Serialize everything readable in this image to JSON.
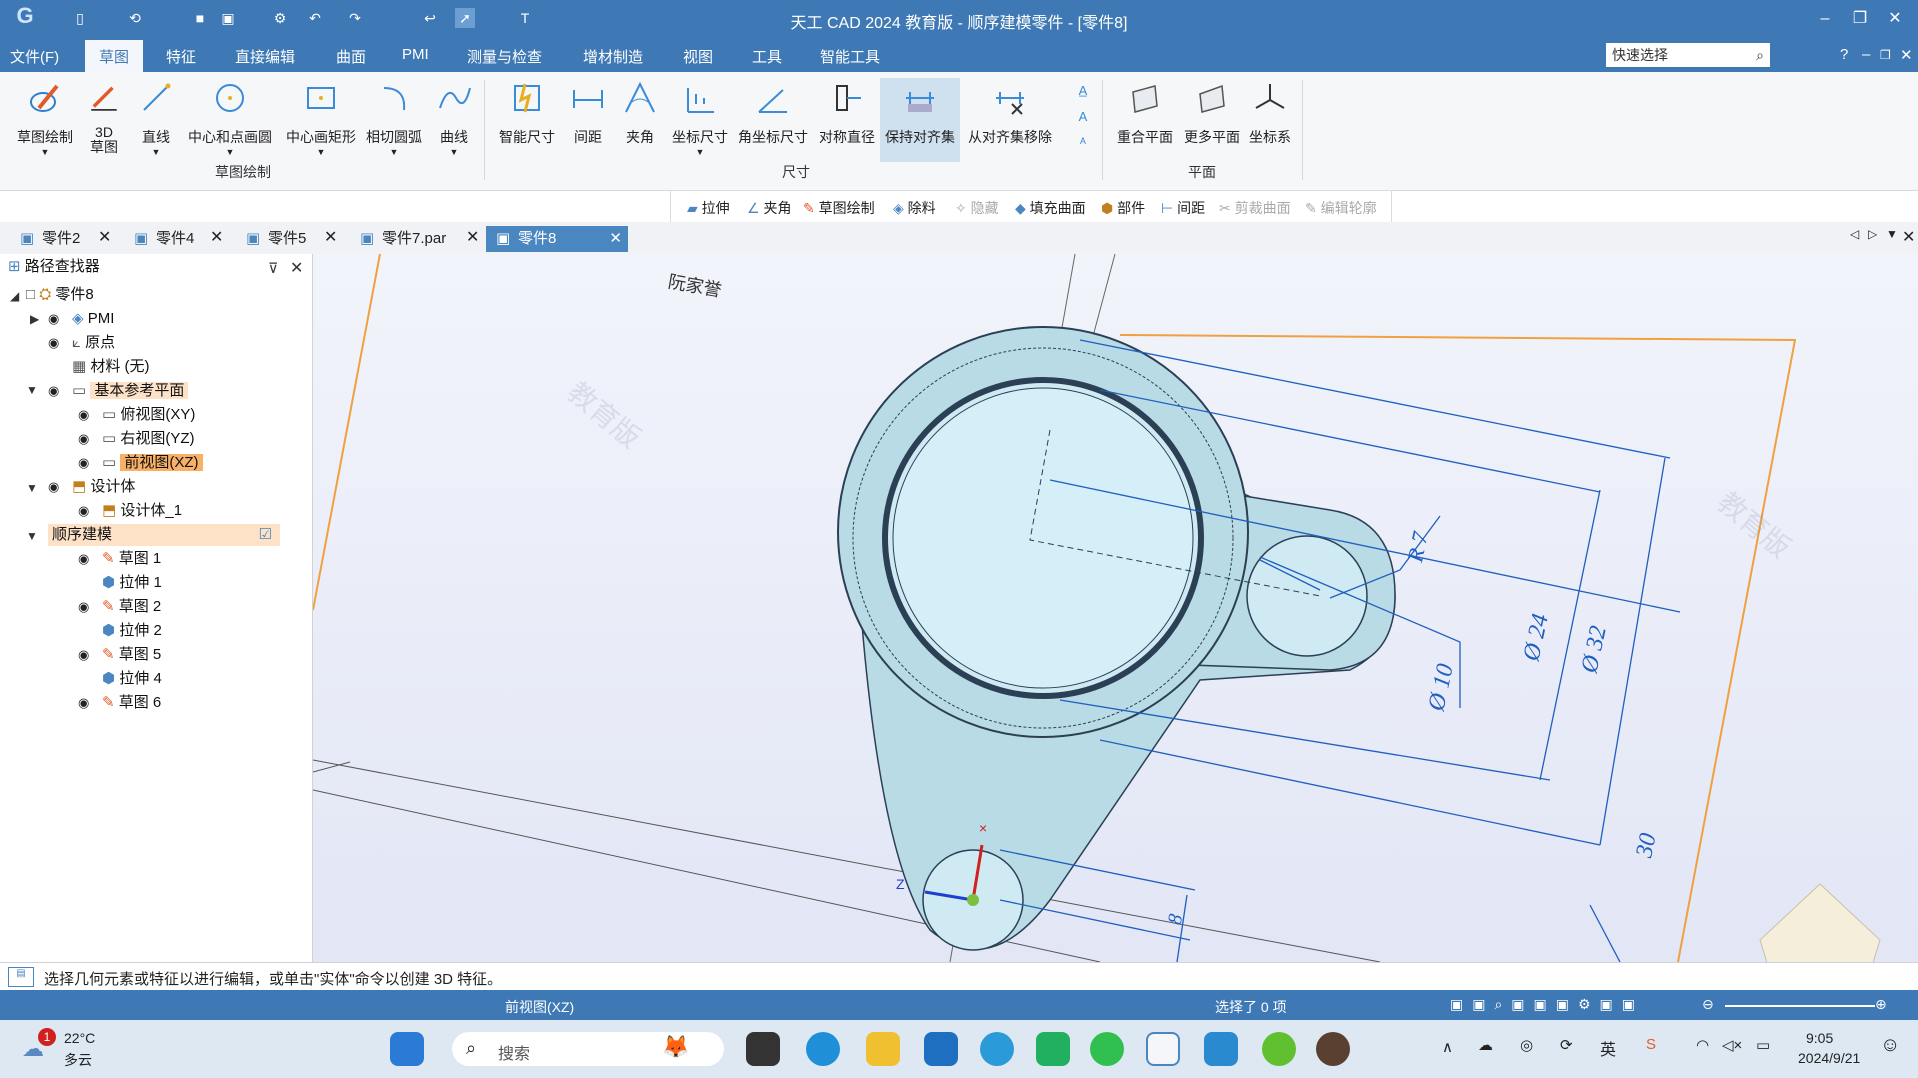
{
  "titlebar": {
    "title": "天工 CAD 2024 教育版 - 顺序建模零件 - [零件8]"
  },
  "menu": {
    "file": "文件(F)",
    "sketch": "草图",
    "feature": "特征",
    "direct_edit": "直接编辑",
    "surface": "曲面",
    "pmi": "PMI",
    "measure": "测量与检查",
    "additive": "增材制造",
    "view": "视图",
    "tools": "工具",
    "smart_tools": "智能工具",
    "quick_select": "快速选择",
    "help": "?"
  },
  "ribbon": {
    "sketch_draw": "草图绘制",
    "sketch3d_a": "3D",
    "sketch3d_b": "草图",
    "line": "直线",
    "center_circle": "中心和点画圆",
    "center_rect": "中心画矩形",
    "tangent_arc": "相切圆弧",
    "curve": "曲线",
    "group_sketch": "草图绘制",
    "smart_dim": "智能尺寸",
    "distance": "间距",
    "angle": "夹角",
    "coord_dim": "坐标尺寸",
    "angle_coord_dim": "角坐标尺寸",
    "sym_diameter": "对称直径",
    "keep_align": "保持对齐集",
    "remove_align": "从对齐集移除",
    "group_dim": "尺寸",
    "coincident_plane": "重合平面",
    "more_planes": "更多平面",
    "coord_sys": "坐标系",
    "group_plane": "平面"
  },
  "featurebar": {
    "extrude": "拉伸",
    "angle": "夹角",
    "sketch": "草图绘制",
    "remove": "除料",
    "hide": "隐藏",
    "fill_surface": "填充曲面",
    "part": "部件",
    "distance": "间距",
    "trim_surface": "剪裁曲面",
    "edit_profile": "编辑轮廓"
  },
  "tabs": [
    "零件2",
    "零件4",
    "零件5",
    "零件7.par",
    "零件8"
  ],
  "pathfinder": {
    "title": "路径查找器",
    "root": "零件8",
    "pmi": "PMI",
    "origin": "原点",
    "material": "材料 (无)",
    "base_planes": "基本参考平面",
    "top_view": "俯视图(XY)",
    "right_view": "右视图(YZ)",
    "front_view": "前视图(XZ)",
    "design_body": "设计体",
    "design_body_1": "设计体_1",
    "sequential": "顺序建模",
    "items": [
      "草图 1",
      "拉伸 1",
      "草图 2",
      "拉伸 2",
      "草图 5",
      "拉伸 4",
      "草图 6"
    ]
  },
  "viewport": {
    "author": "阮家誉",
    "watermark": "教育版",
    "dim_r7": "R 7",
    "dim_d24": "Ø 24",
    "dim_d32": "Ø 32",
    "dim_d10": "Ø 10",
    "dim_30": "30",
    "dim_8": "8",
    "axis_z": "Z",
    "axis_x": "×"
  },
  "prompt": {
    "text": "选择几何元素或特征以进行编辑，或单击\"实体\"命令以创建 3D 特征。"
  },
  "status": {
    "view": "前视图(XZ)",
    "selected": "选择了 0 项"
  },
  "taskbar": {
    "temp": "22°C",
    "weather": "多云",
    "badge": "1",
    "search": "搜索",
    "ime": "英",
    "time": "9:05",
    "date": "2024/9/21"
  },
  "colors": {
    "titlebar": "#3f79b5",
    "part_fill": "#b9dbe6",
    "dim": "#1f5fbf",
    "frame": "#f0a040"
  }
}
